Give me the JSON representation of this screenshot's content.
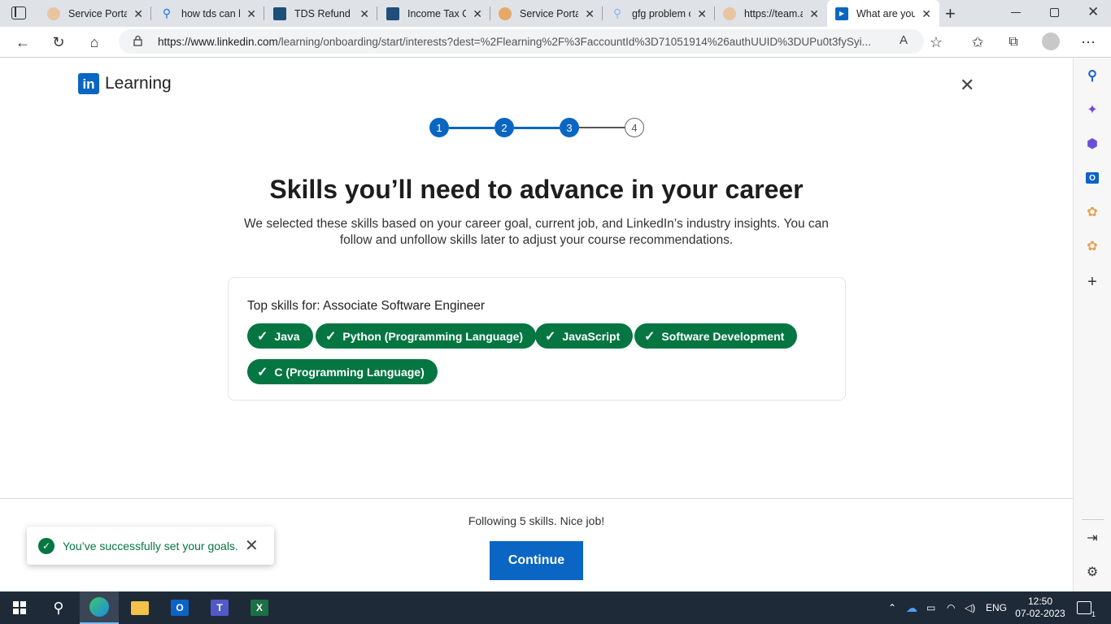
{
  "browser": {
    "tabs": [
      {
        "title": "Service Portal",
        "favicon": "service-portal-icon",
        "color": "#e0b088",
        "active": false
      },
      {
        "title": "how tds can b",
        "favicon": "search-icon",
        "color": "#1a73e8",
        "active": false
      },
      {
        "title": "TDS Refund -",
        "favicon": "income-tax-icon",
        "color": "#1f4e79",
        "active": false
      },
      {
        "title": "Income Tax C",
        "favicon": "income-tax-icon",
        "color": "#1f4e79",
        "active": false
      },
      {
        "title": "Service Portal",
        "favicon": "service-portal-icon",
        "color": "#e0a060",
        "active": false
      },
      {
        "title": "gfg problem o",
        "favicon": "search-icon",
        "color": "#1a73e8",
        "active": false
      },
      {
        "title": "https://team.a",
        "favicon": "service-portal-icon",
        "color": "#e0b088",
        "active": false
      },
      {
        "title": "What are you",
        "favicon": "linkedin-learning-icon",
        "color": "#0a66c2",
        "active": true
      }
    ],
    "url_prefix": "https://www.linkedin.com",
    "url_rest": "/learning/onboarding/start/interests?dest=%2Flearning%2F%3FaccountId%3D71051914%26authUUID%3DUPu0t3fySyi..."
  },
  "page": {
    "logo_text": "Learning",
    "logo_badge": "in",
    "steps": [
      "1",
      "2",
      "3",
      "4"
    ],
    "current_step": 3,
    "headline": "Skills you’ll need to advance in your career",
    "subtext": "We selected these skills based on your career goal, current job, and LinkedIn’s industry insights. You can follow and unfollow skills later to adjust your course recommendations.",
    "card_title": "Top skills for: Associate Software Engineer",
    "skills": [
      "Java",
      "Python (Programming Language)",
      "JavaScript",
      "Software Development",
      "C (Programming Language)"
    ],
    "following_text": "Following 5 skills. Nice job!",
    "continue_label": "Continue",
    "toast_message": "You’ve successfully set your goals."
  },
  "taskbar": {
    "time": "12:50",
    "date": "07-02-2023",
    "language": "ENG",
    "notification_count": "1"
  },
  "colors": {
    "linkedin_blue": "#0a66c2",
    "skill_green": "#057642"
  }
}
